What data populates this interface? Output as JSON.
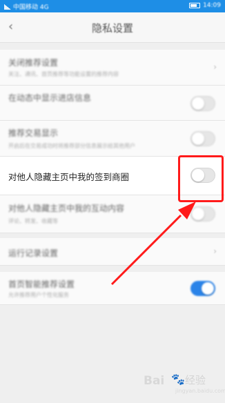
{
  "status_bar": {
    "left_text": "中国移动 4G",
    "right_text": "14:09"
  },
  "nav": {
    "title": "隐私设置"
  },
  "rows": [
    {
      "title": "关闭推荐设置",
      "subtitle": "关注、通讯、首页推荐等功能设置的推荐内容",
      "control": "chevron"
    },
    {
      "title": "在动态中显示进店信息",
      "subtitle": "",
      "control": "toggle",
      "on": false
    },
    {
      "title": "推荐交易显示",
      "subtitle": "开启后在交易成功时将推荐部分信息展示给其他用户",
      "control": "toggle",
      "on": false
    },
    {
      "title": "对他人隐藏主页中我的签到商圈",
      "subtitle": "",
      "control": "toggle",
      "on": false
    },
    {
      "title": "对他人隐藏主页中我的互动内容",
      "subtitle": "评论、转发、收藏等",
      "control": "toggle",
      "on": false
    },
    {
      "title": "运行记录设置",
      "subtitle": "",
      "control": "chevron"
    },
    {
      "title": "首页智能推荐设置",
      "subtitle": "允许推荐用户个性化服务",
      "control": "toggle",
      "on": true
    }
  ],
  "icons": {
    "back": "chevron-left-icon",
    "chevron": "chevron-right-icon"
  },
  "annotation": {
    "box_color": "#ff1a1a",
    "arrow_color": "#ff1a1a"
  },
  "watermark": {
    "logo": "Bai",
    "text": "经验",
    "url": "jingyan.baidu.com"
  },
  "colors": {
    "status_bar": "#1e8ee6",
    "toggle_on": "#2a83e8"
  }
}
